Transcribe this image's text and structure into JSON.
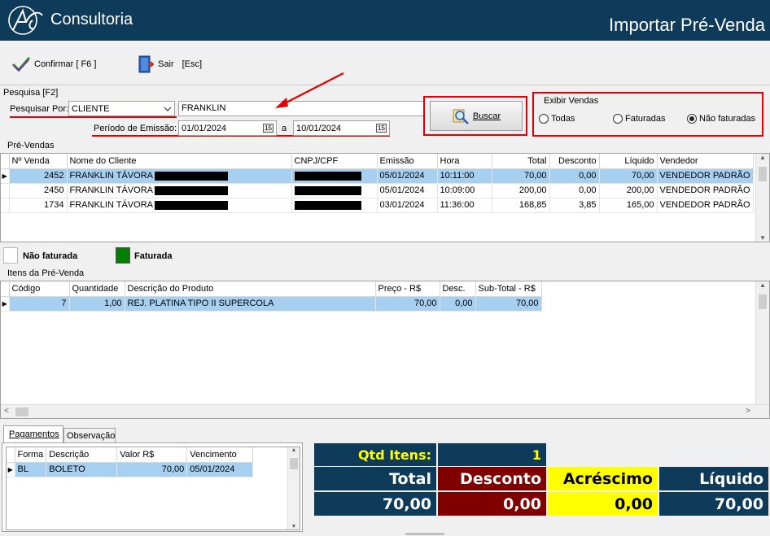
{
  "header": {
    "brand": "Consultoria",
    "logo_text": "AC",
    "title": "Importar Pré-Venda"
  },
  "toolbar": {
    "confirm_label": "Confirmar [ F6 ]",
    "exit_label": "Sair",
    "exit_shortcut": "[Esc]"
  },
  "search": {
    "group_label": "Pesquisa [F2]",
    "by_label": "Pesquisar Por:",
    "by_value": "CLIENTE",
    "term_value": "FRANKLIN",
    "period_label": "Período de Emissão:",
    "date_from": "01/01/2024",
    "date_sep": "a",
    "date_to": "10/01/2024",
    "search_button": "Buscar"
  },
  "filter": {
    "group_label": "Exibir Vendas",
    "options": [
      "Todas",
      "Faturadas",
      "Não faturadas"
    ],
    "selected": "Não faturadas"
  },
  "presales": {
    "section_label": "Pré-Vendas",
    "columns": [
      "Nº Venda",
      "Nome do Cliente",
      "CNPJ/CPF",
      "Emissão",
      "Hora",
      "Total",
      "Desconto",
      "Líquido",
      "Vendedor"
    ],
    "rows": [
      {
        "numero": "2452",
        "cliente": "FRANKLIN TÁVORA",
        "emissao": "05/01/2024",
        "hora": "10:11:00",
        "total": "70,00",
        "desconto": "0,00",
        "liquido": "70,00",
        "vendedor": "VENDEDOR PADRÃO"
      },
      {
        "numero": "2450",
        "cliente": "FRANKLIN TÁVORA",
        "emissao": "05/01/2024",
        "hora": "10:09:00",
        "total": "200,00",
        "desconto": "0,00",
        "liquido": "200,00",
        "vendedor": "VENDEDOR PADRÃO"
      },
      {
        "numero": "1734",
        "cliente": "FRANKLIN TÁVORA",
        "emissao": "03/01/2024",
        "hora": "11:36:00",
        "total": "168,85",
        "desconto": "3,85",
        "liquido": "165,00",
        "vendedor": "VENDEDOR PADRÃO"
      }
    ]
  },
  "legend": {
    "not_invoiced": "Não faturada",
    "invoiced": "Faturada",
    "not_invoiced_color": "#ffffff",
    "invoiced_color": "#008000"
  },
  "items": {
    "section_label": "Itens da Pré-Venda",
    "columns": [
      "Código",
      "Quantidade",
      "Descrição do Produto",
      "Preço - R$",
      "Desc.",
      "Sub-Total - R$"
    ],
    "rows": [
      {
        "codigo": "7",
        "quantidade": "1,00",
        "descricao": "REJ. PLATINA TIPO II SUPERCOLA",
        "preco": "70,00",
        "desc": "0,00",
        "subtotal": "70,00"
      }
    ]
  },
  "payments": {
    "tabs": [
      "Pagamentos",
      "Observação"
    ],
    "active_tab": "Pagamentos",
    "columns": [
      "Forma",
      "Descrição",
      "Valor R$",
      "Vencimento"
    ],
    "rows": [
      {
        "forma": "BL",
        "descricao": "BOLETO",
        "valor": "70,00",
        "vencimento": "05/01/2024"
      }
    ]
  },
  "summary": {
    "qtd_label": "Qtd Itens:",
    "qtd_value": "1",
    "total_label": "Total",
    "total_value": "70,00",
    "desconto_label": "Desconto",
    "desconto_value": "0,00",
    "acrescimo_label": "Acréscimo",
    "acrescimo_value": "0,00",
    "liquido_label": "Líquido",
    "liquido_value": "70,00",
    "colors": {
      "navy": "#0f3b5a",
      "maroon": "#800000",
      "yellow": "#ffff00"
    }
  }
}
